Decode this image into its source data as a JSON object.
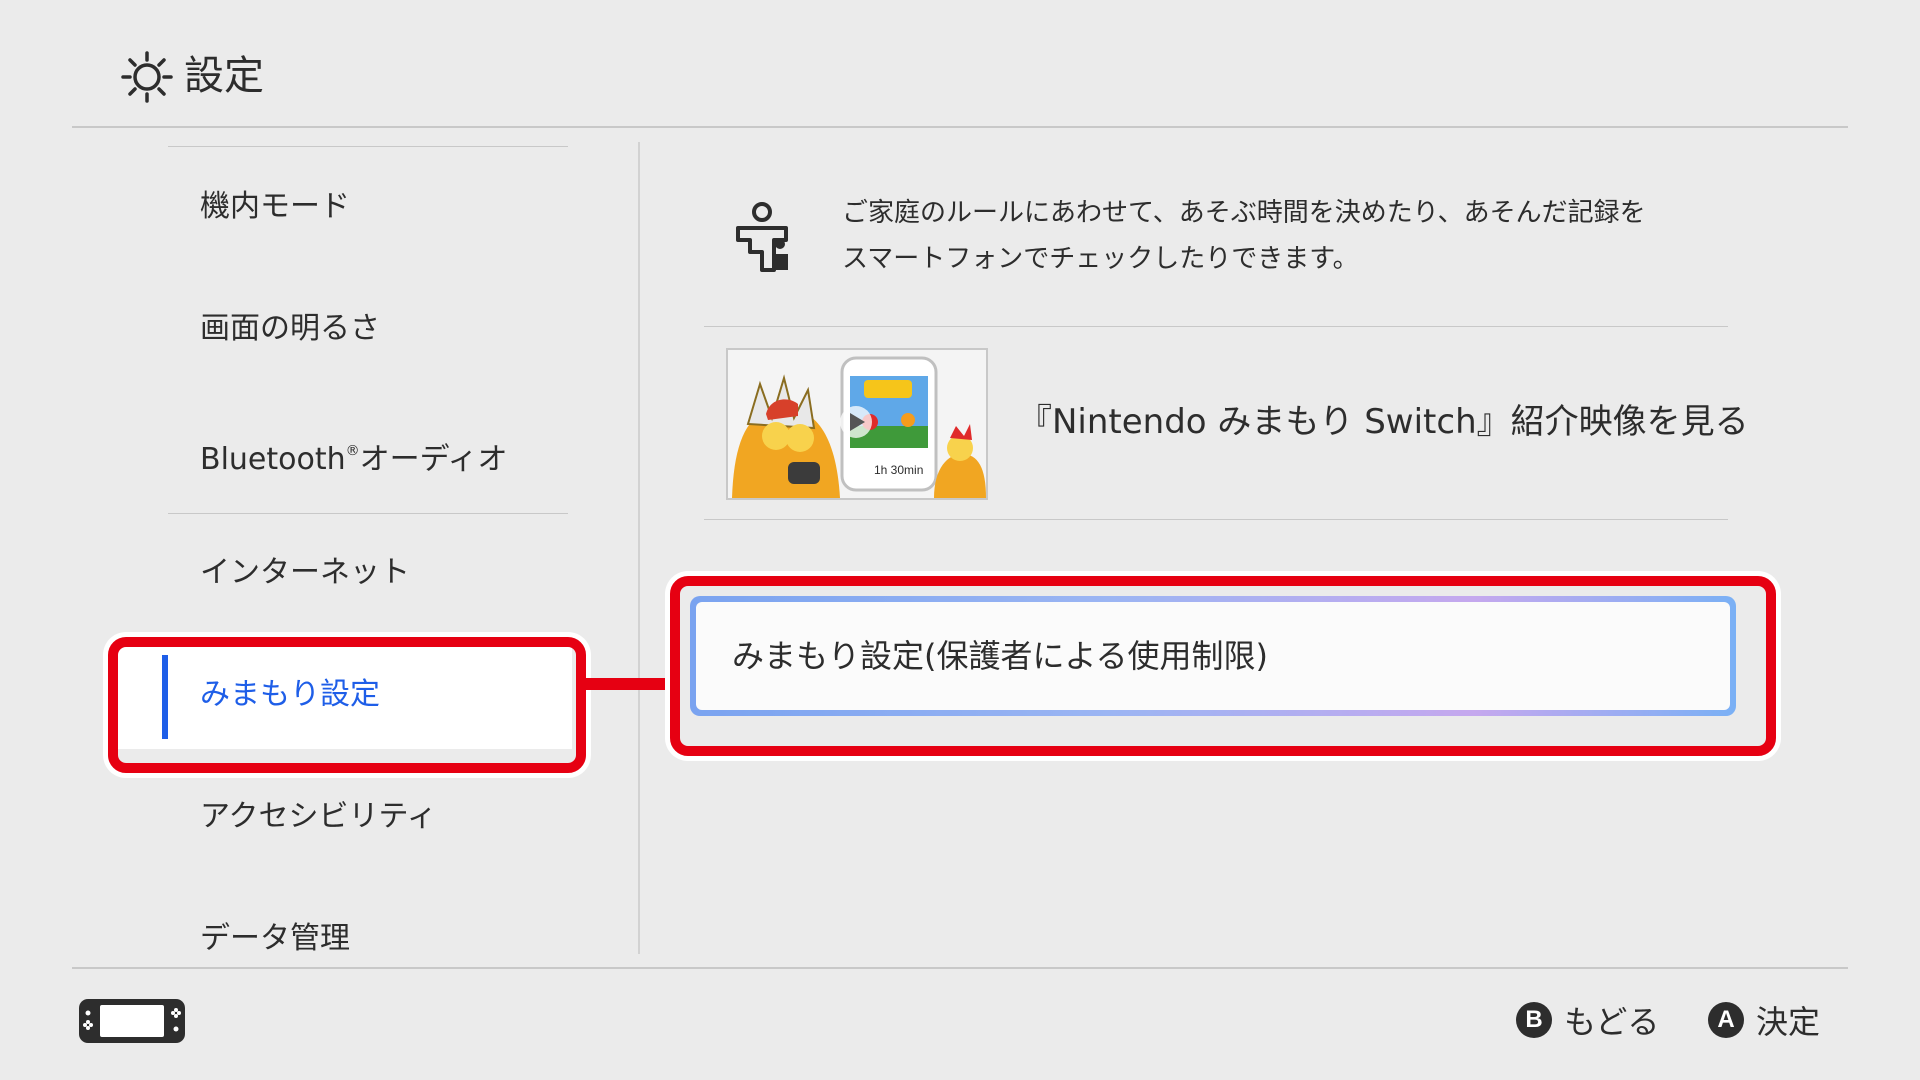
{
  "header": {
    "title": "設定",
    "icon": "gear-icon"
  },
  "sidebar": {
    "items": [
      {
        "label": "機内モード"
      },
      {
        "label": "画面の明るさ"
      },
      {
        "label": "Bluetooth",
        "sup": "®",
        "suffix": "オーディオ"
      },
      {
        "label": "インターネット"
      },
      {
        "label": "みまもり設定",
        "selected": true
      },
      {
        "label": "アクセシビリティ"
      },
      {
        "label": "データ管理"
      }
    ]
  },
  "main": {
    "intro_line1": "ご家庭のルールにあわせて、あそぶ時間を決めたり、あそんだ記録を",
    "intro_line2": "スマートフォンでチェックしたりできます。",
    "intro_icon": "child-guardian-icon",
    "video": {
      "label": "『Nintendo みまもり Switch』紹介映像を見る",
      "thumbnail_time": "1h 30min",
      "thumbnail_icon": "play-icon"
    },
    "settings_button_label": "みまもり設定(保護者による使用制限)"
  },
  "footer": {
    "console_icon": "switch-console-icon",
    "back": {
      "glyph": "B",
      "label": "もどる"
    },
    "confirm": {
      "glyph": "A",
      "label": "決定"
    }
  },
  "colors": {
    "background": "#ebebeb",
    "accent_blue": "#1e5ee8",
    "annotation_red": "#e60012",
    "text": "#2d2d2d"
  }
}
